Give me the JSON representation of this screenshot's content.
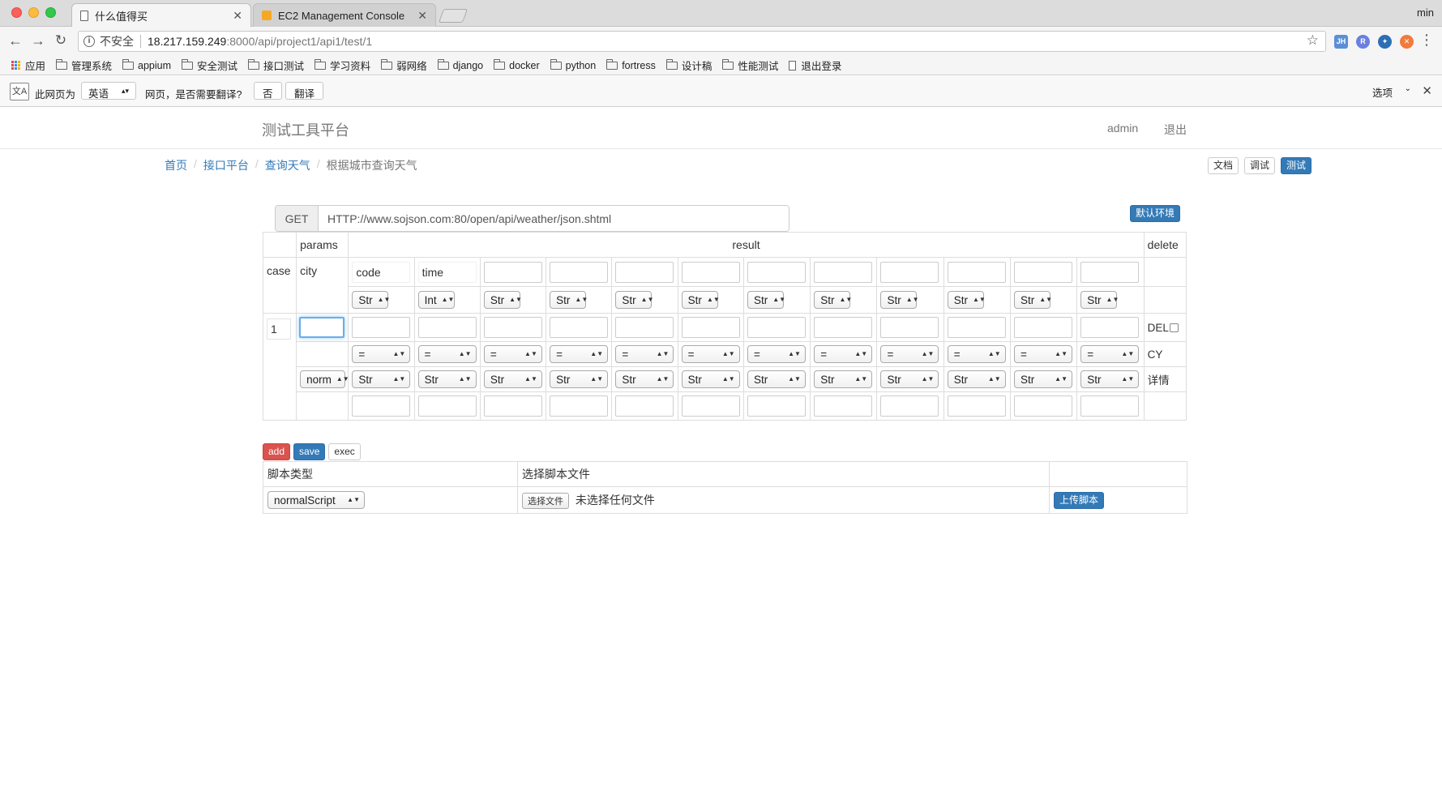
{
  "browser": {
    "tabs": [
      {
        "title": "什么值得买",
        "active": true
      },
      {
        "title": "EC2 Management Console",
        "active": false
      }
    ],
    "profile": "min",
    "address": {
      "security": "不安全",
      "host": "18.217.159.249",
      "path": ":8000/api/project1/api1/test/1"
    },
    "bookmarks": [
      "应用",
      "管理系统",
      "appium",
      "安全测试",
      "接口测试",
      "学习资料",
      "弱网络",
      "django",
      "docker",
      "python",
      "fortress",
      "设计稿",
      "性能测试",
      "退出登录"
    ],
    "extensions": [
      {
        "name": "JH",
        "color": "#5a8fd8"
      },
      {
        "name": "R",
        "color": "#6b7fe0"
      },
      {
        "name": "",
        "color": "#2c6fb5"
      },
      {
        "name": "",
        "color": "#f07b3c"
      }
    ],
    "translate_bar": {
      "prefix": "此网页为",
      "language": "英语",
      "question": "网页，是否需要翻译?",
      "no_label": "否",
      "translate_label": "翻译",
      "options_label": "选项"
    }
  },
  "navbar": {
    "brand": "测试工具平台",
    "user": "admin",
    "logout": "退出"
  },
  "breadcrumb": {
    "items": [
      "首页",
      "接口平台",
      "查询天气"
    ],
    "current": "根据城市查询天气"
  },
  "mode_buttons": {
    "doc": "文档",
    "debug": "调试",
    "test": "测试"
  },
  "request": {
    "method": "GET",
    "url": "HTTP://www.sojson.com:80/open/api/weather/json.shtml",
    "env_button": "默认环境"
  },
  "table": {
    "headers": {
      "params": "params",
      "result": "result",
      "delete": "delete"
    },
    "case_label": "case",
    "param_name": "city",
    "result_fields": [
      "code",
      "time",
      "",
      "",
      "",
      "",
      "",
      "",
      "",
      "",
      "",
      ""
    ],
    "result_types": [
      "Str",
      "Int",
      "Str",
      "Str",
      "Str",
      "Str",
      "Str",
      "Str",
      "Str",
      "Str",
      "Str",
      "Str"
    ],
    "case_row": {
      "case_no": "1",
      "param_value": "",
      "operators": [
        "=",
        "=",
        "=",
        "=",
        "=",
        "=",
        "=",
        "=",
        "=",
        "=",
        "=",
        "="
      ],
      "param_type": "norm",
      "value_types": [
        "Str",
        "Str",
        "Str",
        "Str",
        "Str",
        "Str",
        "Str",
        "Str",
        "Str",
        "Str",
        "Str",
        "Str"
      ],
      "del_label": "DEL",
      "cy_label": "CY",
      "detail_label": "详情"
    }
  },
  "actions": {
    "add": "add",
    "save": "save",
    "exec": "exec"
  },
  "script": {
    "type_header": "脚本类型",
    "file_header": "选择脚本文件",
    "type_value": "normalScript",
    "choose_file": "选择文件",
    "no_file": "未选择任何文件",
    "upload": "上传脚本"
  }
}
